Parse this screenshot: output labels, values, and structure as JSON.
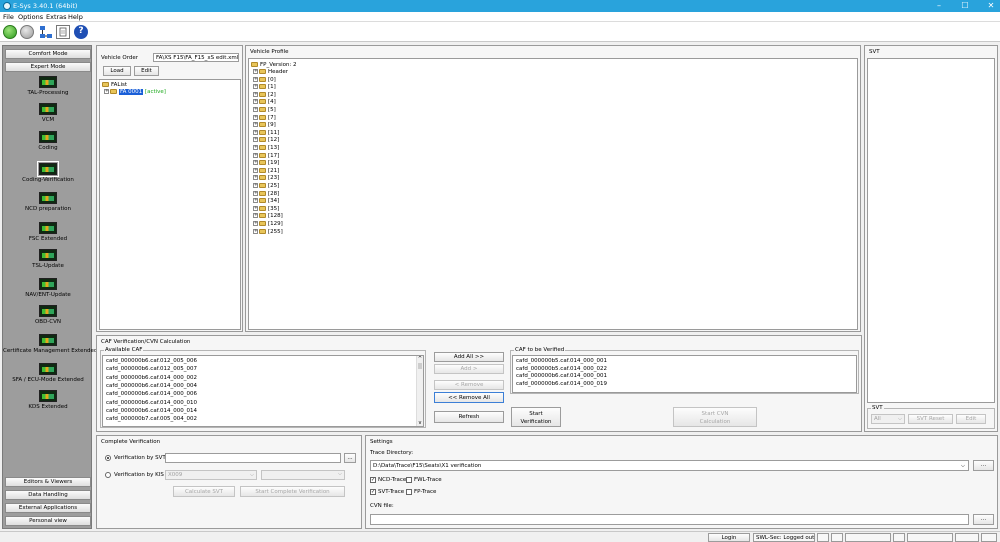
{
  "window": {
    "title": "E-Sys 3.40.1  (64bit)",
    "minimize": "–",
    "maximize": "☐",
    "close": "✕"
  },
  "menu": [
    "File",
    "Options",
    "Extras",
    "Help"
  ],
  "toolbar": {
    "icons": [
      "connect-icon",
      "disconnect-icon",
      "network-icon",
      "document-icon",
      "help-icon"
    ]
  },
  "left_nav": {
    "modes": [
      "Comfort Mode",
      "Expert Mode"
    ],
    "tools": [
      "TAL-Processing",
      "VCM",
      "Coding",
      "Coding-Verification",
      "NCD preparation",
      "FSC Extended",
      "TSL-Update",
      "NAV/ENT-Update",
      "OBD-CVN",
      "Certificate Management Extended",
      "SFA / ECU-Mode Extended",
      "KDS Extended"
    ],
    "selected_tool": "Coding-Verification",
    "bottom": [
      "Editors & Viewers",
      "Data Handling",
      "External Applications",
      "Personal view"
    ]
  },
  "vehicle_order": {
    "label": "Vehicle Order",
    "path": "FA\\XS F15\\FA_F15_xS edit.xml",
    "load_button": "Load",
    "edit_button": "Edit",
    "tree_root": "FAList",
    "tree_child": "FA 0001",
    "tree_child_status": "[active]"
  },
  "vehicle_profile": {
    "label": "Vehicle Profile",
    "root": "FP_Version: 2",
    "items": [
      "Header",
      "[0]",
      "[1]",
      "[2]",
      "[4]",
      "[5]",
      "[7]",
      "[9]",
      "[11]",
      "[12]",
      "[13]",
      "[17]",
      "[19]",
      "[21]",
      "[23]",
      "[25]",
      "[28]",
      "[34]",
      "[35]",
      "[128]",
      "[129]",
      "[255]"
    ]
  },
  "svt": {
    "label": "SVT",
    "group_label": "SVT",
    "select_value": "All",
    "reset_button": "SVT Reset",
    "edit_button": "Edit"
  },
  "caf": {
    "label": "CAF Verification/CVN Calculation",
    "available_label": "Available CAF",
    "available": [
      "cafd_000000b6.caf.012_005_006",
      "cafd_000000b6.caf.012_005_007",
      "cafd_000000b6.caf.014_000_002",
      "cafd_000000b6.caf.014_000_004",
      "cafd_000000b6.caf.014_000_006",
      "cafd_000000b6.caf.014_000_010",
      "cafd_000000b6.caf.014_000_014",
      "cafd_000000b7.caf.005_004_002"
    ],
    "add_all": "Add All >>",
    "add": "Add >",
    "remove": "< Remove",
    "remove_all": "<< Remove All",
    "refresh": "Refresh",
    "to_verify_label": "CAF to be Verified",
    "to_verify": [
      "cafd_000000b5.caf.014_000_001",
      "cafd_000000b5.caf.014_000_022",
      "cafd_000000b6.caf.014_000_001",
      "cafd_000000b6.caf.014_000_019"
    ],
    "start_verification": [
      "Start",
      "Verification"
    ],
    "start_cvn": [
      "Start CVN",
      "Calculation"
    ]
  },
  "complete_verification": {
    "label": "Complete Verification",
    "by_svt": "Verification by SVT",
    "by_kis": "Verification by KIS",
    "kis_value": "X009",
    "calculate_svt": "Calculate SVT",
    "start_complete": "Start Complete Verification",
    "browse": "..."
  },
  "settings": {
    "label": "Settings",
    "trace_directory_label": "Trace Directory:",
    "trace_directory": "D:\\Data\\Trace\\F15\\Seats\\X1 verification",
    "ncd_trace": "NCD-Trace",
    "fwl_trace": "FWL-Trace",
    "svt_trace": "SVT-Trace",
    "fp_trace": "FP-Trace",
    "ncd_checked": true,
    "fwl_checked": false,
    "svt_checked": true,
    "fp_checked": false,
    "cvn_file_label": "CVN file:",
    "browse": "..."
  },
  "status": {
    "login": "Login",
    "swl_sec": "SWL-Sec: Logged out"
  },
  "colors": {
    "titlebar": "#29a3dc",
    "selection": "#1a5fd8",
    "active_green": "#1faa1f",
    "leftbar": "#9d9d9d"
  }
}
